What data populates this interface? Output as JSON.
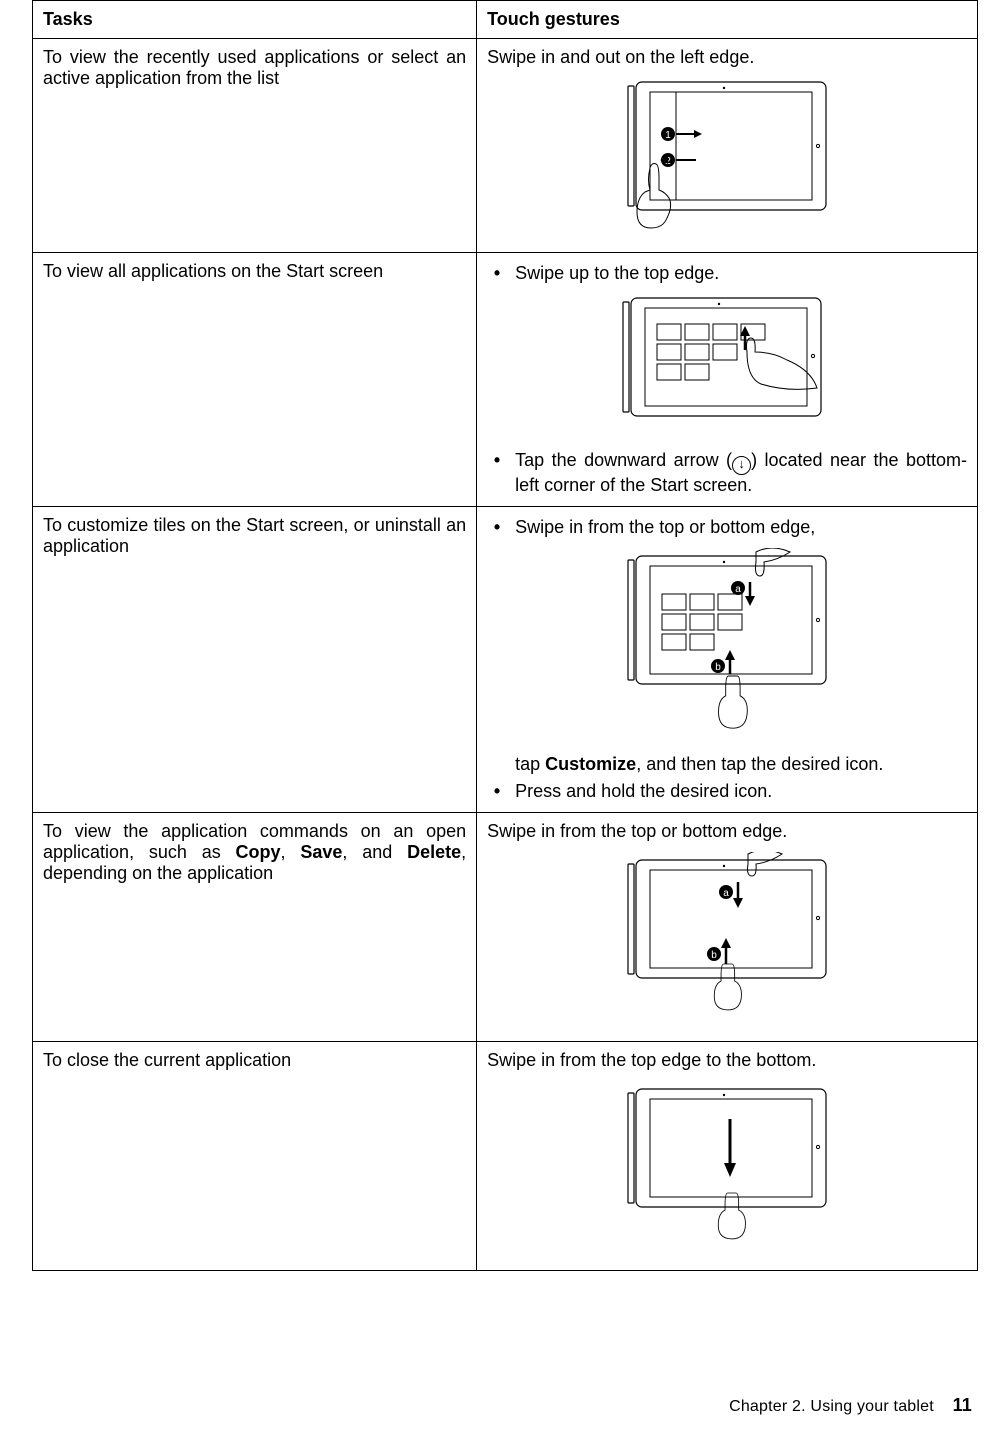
{
  "header": {
    "tasks": "Tasks",
    "gestures": "Touch gestures"
  },
  "rows": [
    {
      "task": "To view the recently used applications or select an active application from the list",
      "gesture": "Swipe in and out on the left edge."
    },
    {
      "task": "To view all applications on the Start screen",
      "b1": "Swipe up to the top edge.",
      "b2a": "Tap the downward arrow (",
      "b2b": ") located near the bottom-left corner of the Start screen."
    },
    {
      "task": "To customize tiles on the Start screen, or uninstall an application",
      "b1": "Swipe in from the top or bottom edge,",
      "b1post_a": "tap ",
      "b1post_bold": "Customize",
      "b1post_b": ", and then tap the desired icon.",
      "b2": "Press and hold the desired icon."
    },
    {
      "task_a": "To view the application commands on an open application, such as ",
      "copy": "Copy",
      "sep1": ", ",
      "save": "Save",
      "sep2": ", and ",
      "delete": "Delete",
      "task_b": ", depending on the application",
      "gesture": "Swipe in from the top or bottom edge."
    },
    {
      "task": "To close the current application",
      "gesture": "Swipe in from the top edge to the bottom."
    }
  ],
  "footer": {
    "chapter": "Chapter 2.  Using your tablet",
    "page": "11"
  },
  "labels": {
    "one": "1",
    "two": "2",
    "a": "a",
    "b": "b"
  }
}
